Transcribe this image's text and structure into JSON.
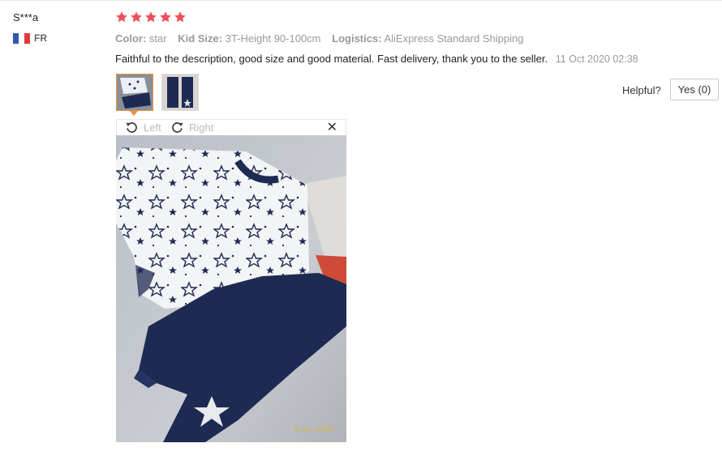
{
  "review": {
    "user": "S***a",
    "country": "FR",
    "rating": 5,
    "attrs": [
      {
        "label": "Color:",
        "value": "star"
      },
      {
        "label": "Kid Size:",
        "value": "3T-Height 90-100cm"
      },
      {
        "label": "Logistics:",
        "value": "AliExpress Standard Shipping"
      }
    ],
    "text": "Faithful to the description, good size and good material. Fast delivery, thank you to the seller.",
    "date": "11 Oct 2020 02:38",
    "helpful_label": "Helpful?",
    "yes_label": "Yes (0)"
  },
  "viewer": {
    "left_label": "Left",
    "right_label": "Right",
    "close_label": "✕",
    "photo_stamp": "9 oct. 2020"
  },
  "colors": {
    "star": "#f0505a",
    "flag_blue": "#3457a8",
    "flag_red": "#e03c3c",
    "accent": "#e9923d",
    "navy": "#1d2a52"
  }
}
